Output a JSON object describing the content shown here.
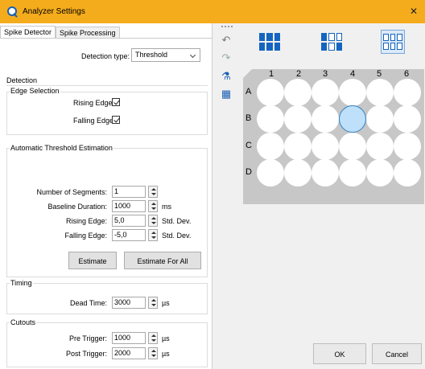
{
  "window": {
    "title": "Analyzer Settings",
    "close_icon": "close-icon",
    "app_icon": "search-icon",
    "accent": "#f5ac1c"
  },
  "tabs": [
    {
      "label": "Spike Detector",
      "active": true
    },
    {
      "label": "Spike Processing",
      "active": false
    }
  ],
  "detection_type": {
    "label": "Detection type:",
    "value": "Threshold"
  },
  "detection": {
    "title": "Detection",
    "edge_selection": {
      "title": "Edge Selection",
      "rising_label": "Rising Edge",
      "rising_checked": true,
      "falling_label": "Falling Edge",
      "falling_checked": true
    },
    "auto_threshold": {
      "title": "Automatic Threshold Estimation",
      "fields": [
        {
          "label": "Number of Segments:",
          "value": "1",
          "unit": ""
        },
        {
          "label": "Baseline Duration:",
          "value": "1000",
          "unit": "ms"
        },
        {
          "label": "Rising Edge:",
          "value": "5,0",
          "unit": "Std. Dev."
        },
        {
          "label": "Falling Edge:",
          "value": "-5,0",
          "unit": "Std. Dev."
        }
      ],
      "estimate_button": "Estimate",
      "estimate_all_button": "Estimate For All"
    }
  },
  "timing": {
    "title": "Timing",
    "dead_time_label": "Dead Time:",
    "dead_time_value": "3000",
    "dead_time_unit": "µs"
  },
  "cutouts": {
    "title": "Cutouts",
    "pre_label": "Pre Trigger:",
    "pre_value": "1000",
    "pre_unit": "µs",
    "post_label": "Post Trigger:",
    "post_value": "2000",
    "post_unit": "µs"
  },
  "toolbar": {
    "icons": [
      "undo-icon",
      "redo-icon",
      "flask-icon",
      "calculator-grid-icon"
    ]
  },
  "layouts": [
    {
      "icon": "grid-filled-icon",
      "selected": false
    },
    {
      "icon": "grid-mixed-icon",
      "selected": false
    },
    {
      "icon": "grid-outline-icon",
      "selected": true
    }
  ],
  "plate": {
    "columns": [
      "1",
      "2",
      "3",
      "4",
      "5",
      "6"
    ],
    "rows": [
      "A",
      "B",
      "C",
      "D"
    ],
    "selected_well": "B4",
    "selected_color": "#bfe0fa"
  },
  "buttons": {
    "ok": "OK",
    "cancel": "Cancel"
  }
}
